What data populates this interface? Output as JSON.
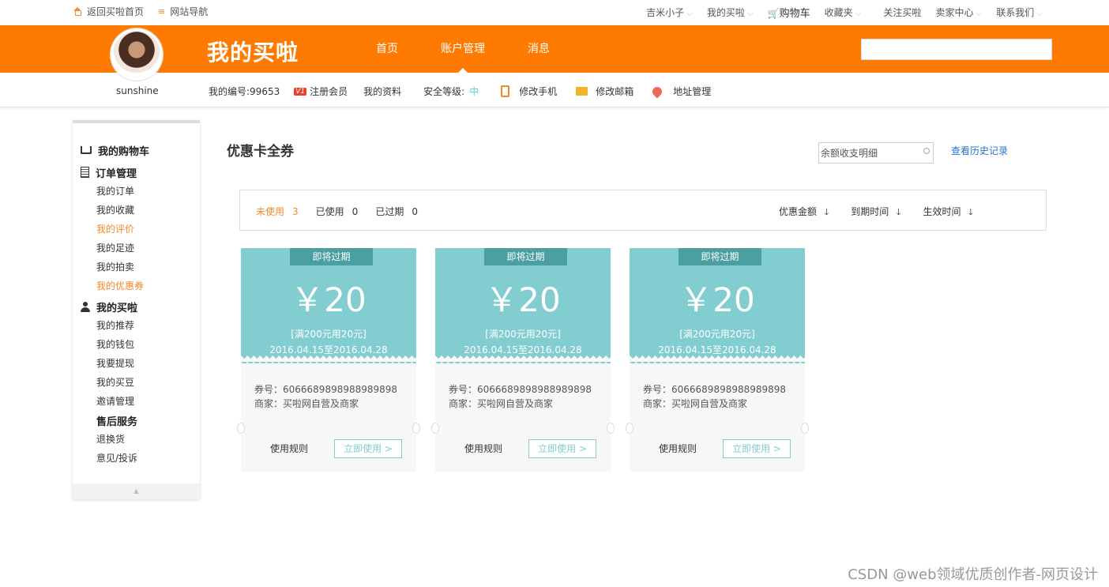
{
  "topbar": {
    "home_link": "返回买啦首页",
    "site_nav": "网站导航",
    "user_menu": "吉米小子",
    "my_buy": "我的买啦",
    "cart": "购物车",
    "favorites": "收藏夹",
    "follow": "关注买啦",
    "seller": "卖家中心",
    "contact": "联系我们"
  },
  "header": {
    "brand": "我的买啦",
    "nav": [
      "首页",
      "账户管理",
      "消息"
    ],
    "search_placeholder": ""
  },
  "info": {
    "username": "sunshine",
    "user_no": "我的编号:99653",
    "vip_badge": "V1",
    "register": "注册会员",
    "profile": "我的资料",
    "security_label": "安全等级:",
    "security_level": "中",
    "phone": "修改手机",
    "email": "修改邮箱",
    "address": "地址管理"
  },
  "sidebar": {
    "cart": "我的购物车",
    "order_mgmt": "订单管理",
    "order_items": [
      "我的订单",
      "我的收藏",
      "我的评价",
      "我的足迹",
      "我的拍卖",
      "我的优惠券"
    ],
    "my_maila": "我的买啦",
    "maila_items": [
      "我的推荐",
      "我的钱包",
      "我要提现",
      "我的买豆",
      "邀请管理"
    ],
    "after_sale": "售后服务",
    "after_items": [
      "退换货",
      "意见/投诉"
    ]
  },
  "main": {
    "title": "优惠卡全券",
    "balance_search": "余额收支明细",
    "history_link": "查看历史记录",
    "tabs": [
      {
        "label": "未使用",
        "count": "3"
      },
      {
        "label": "已使用",
        "count": "0"
      },
      {
        "label": "已过期",
        "count": "0"
      }
    ],
    "sorts": [
      "优惠金额",
      "到期时间",
      "生效时间"
    ]
  },
  "coupons": [
    {
      "badge": "即将过期",
      "amount": "￥20",
      "condition": "[满200元用20元]",
      "dates": "2016.04.15至2016.04.28",
      "code": "券号：6066689898988989898",
      "merchant": "商家：买啦网自营及商家",
      "rules": "使用规则",
      "use": "立即使用 >"
    },
    {
      "badge": "即将过期",
      "amount": "￥20",
      "condition": "[满200元用20元]",
      "dates": "2016.04.15至2016.04.28",
      "code": "券号：6066689898988989898",
      "merchant": "商家：买啦网自营及商家",
      "rules": "使用规则",
      "use": "立即使用 >"
    },
    {
      "badge": "即将过期",
      "amount": "￥20",
      "condition": "[满200元用20元]",
      "dates": "2016.04.15至2016.04.28",
      "code": "券号：6066689898988989898",
      "merchant": "商家：买啦网自营及商家",
      "rules": "使用规则",
      "use": "立即使用 >"
    }
  ],
  "watermark": "CSDN @web领域优质创作者-网页设计",
  "colors": {
    "brand_orange": "#ff7a00",
    "coupon_teal": "#81cdd0",
    "badge_teal": "#4b9fa1",
    "highlight": "#f08a2c",
    "link_blue": "#2a72c8"
  }
}
